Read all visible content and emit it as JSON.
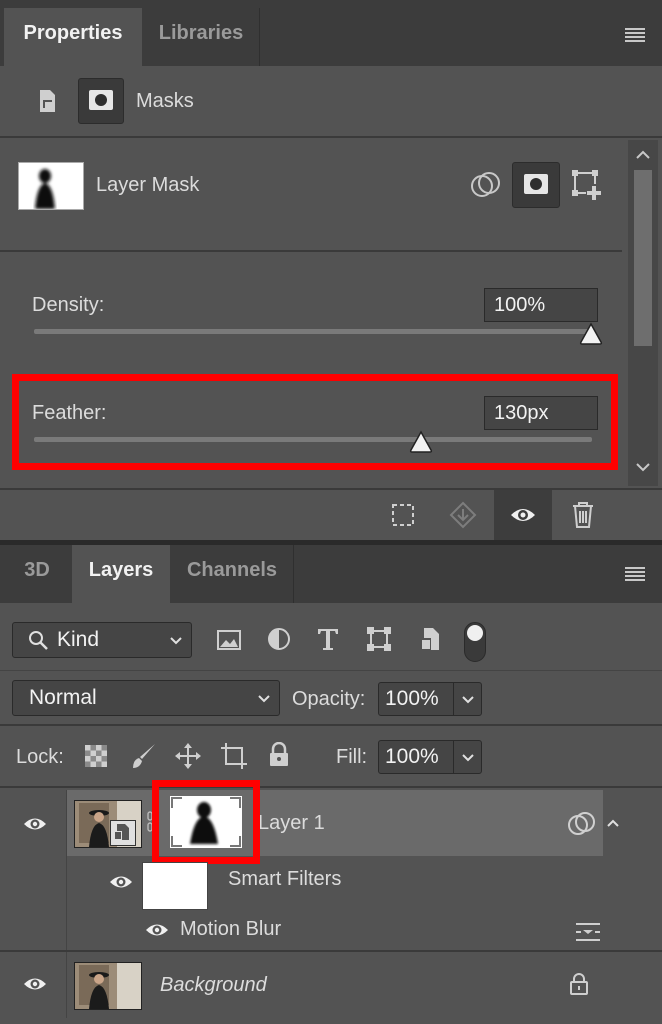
{
  "properties_panel": {
    "tabs": [
      {
        "label": "Properties",
        "active": true
      },
      {
        "label": "Libraries",
        "active": false
      }
    ],
    "section_label": "Masks",
    "mask": {
      "label": "Layer Mask",
      "density_label": "Density:",
      "density_value": "100%",
      "density_fraction": 1.0,
      "feather_label": "Feather:",
      "feather_value": "130px",
      "feather_fraction": 0.67
    },
    "bottom_icons": [
      "load-selection-icon",
      "apply-mask-icon",
      "visibility-icon",
      "trash-icon"
    ]
  },
  "layers_panel": {
    "tabs": [
      {
        "label": "3D",
        "active": false
      },
      {
        "label": "Layers",
        "active": true
      },
      {
        "label": "Channels",
        "active": false
      }
    ],
    "filter": {
      "kind_label": "Kind",
      "icons": [
        "image-filter-icon",
        "adjustment-filter-icon",
        "type-filter-icon",
        "shape-filter-icon",
        "smart-object-filter-icon"
      ]
    },
    "blend_mode": "Normal",
    "opacity_label": "Opacity:",
    "opacity_value": "100%",
    "lock_label": "Lock:",
    "fill_label": "Fill:",
    "fill_value": "100%",
    "layers": [
      {
        "name": "Layer 1",
        "selected": true
      },
      {
        "name": "Smart Filters"
      },
      {
        "name": "Motion Blur"
      },
      {
        "name": "Background",
        "italic": true,
        "locked": true
      }
    ]
  },
  "colors": {
    "panel_bg": "#535353",
    "tab_bar_bg": "#3c3c3c",
    "highlight": "#ff0000",
    "selected_row": "#6a6a6a"
  }
}
